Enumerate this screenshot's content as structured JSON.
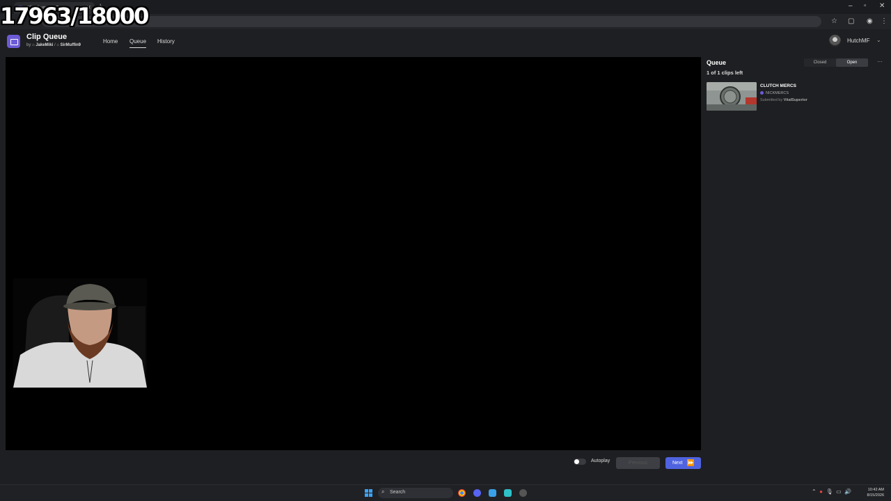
{
  "browser": {
    "tab_title": "Clip Queue - Open",
    "new_tab": "+",
    "window_controls": [
      "–",
      "▫",
      "✕"
    ],
    "toolbar_icons": [
      "star-icon",
      "extensions-icon",
      "profile-icon",
      "menu-icon"
    ]
  },
  "overlay": {
    "counter": "17963/18000"
  },
  "app": {
    "title": "Clip Queue",
    "by_prefix": "by",
    "author_1": "JakeMiki",
    "separator": "/",
    "author_2": "SirMuffin9",
    "accent_color": "#6b5bd6"
  },
  "nav": {
    "home": "Home",
    "queue": "Queue",
    "history": "History",
    "active": "Queue"
  },
  "user": {
    "name": "HutchMF"
  },
  "queue": {
    "title": "Queue",
    "count_text": "1 of 1 clips left",
    "status_closed": "Closed",
    "status_open": "Open",
    "status_selected": "Open",
    "more": "···",
    "clips": [
      {
        "title": "CLUTCH MERCS",
        "channel": "NICKMERCS",
        "submitted_prefix": "Submitted by",
        "submitter": "VitalSuperior"
      }
    ]
  },
  "controls": {
    "autoplay_label": "Autoplay",
    "autoplay_on": false,
    "previous_label": "Previous",
    "next_label": "Next",
    "next_color": "#4f63e0"
  },
  "taskbar": {
    "search_placeholder": "Search",
    "time": "10:42 AM",
    "date": "8/15/2026"
  }
}
